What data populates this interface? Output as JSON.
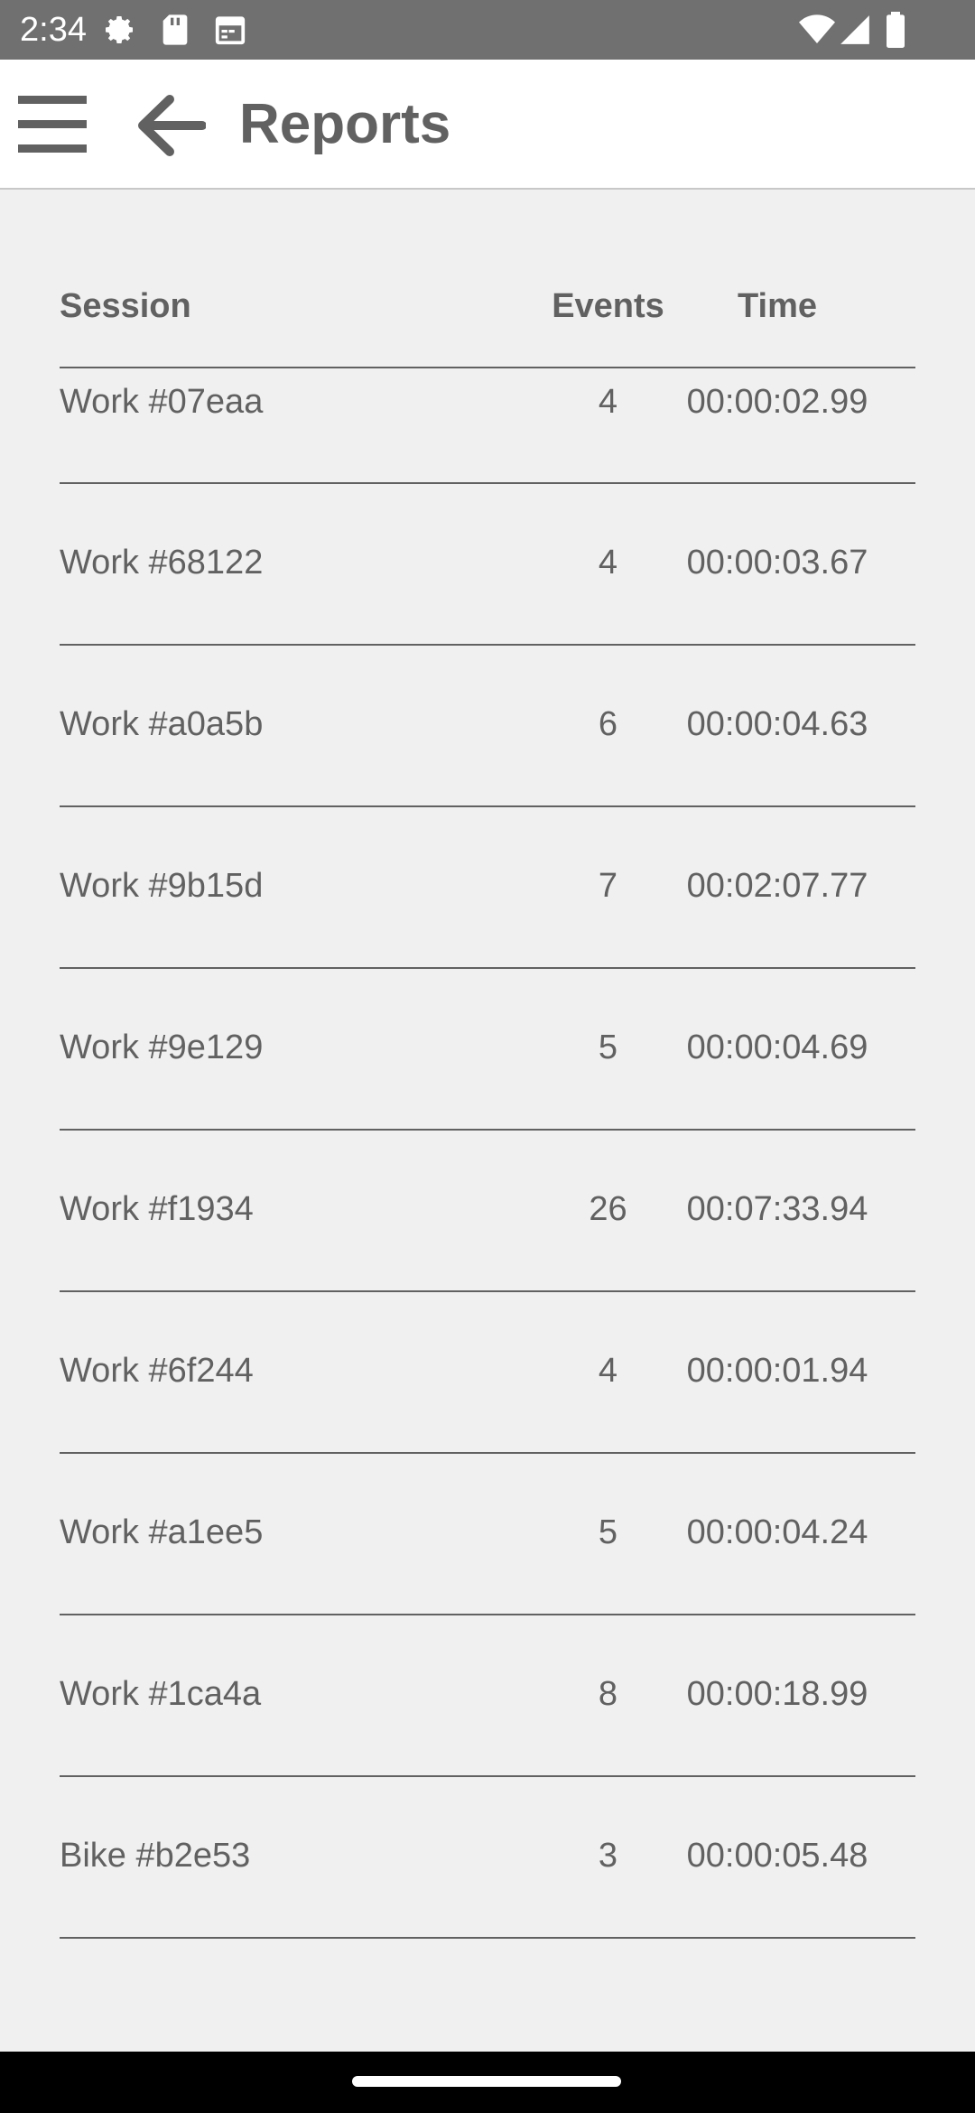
{
  "status_bar": {
    "time": "2:34",
    "icons": [
      "settings-icon",
      "sd-card-icon",
      "calendar-icon",
      "wifi-icon",
      "cell-signal-icon",
      "battery-icon"
    ]
  },
  "app_bar": {
    "title": "Reports",
    "menu_icon": "hamburger-menu-icon",
    "back_icon": "arrow-back-icon"
  },
  "table": {
    "headers": {
      "session": "Session",
      "events": "Events",
      "time": "Time"
    },
    "rows": [
      {
        "session": "Work #07eaa",
        "events": "4",
        "time": "00:00:02.99"
      },
      {
        "session": "Work #68122",
        "events": "4",
        "time": "00:00:03.67"
      },
      {
        "session": "Work #a0a5b",
        "events": "6",
        "time": "00:00:04.63"
      },
      {
        "session": "Work #9b15d",
        "events": "7",
        "time": "00:02:07.77"
      },
      {
        "session": "Work #9e129",
        "events": "5",
        "time": "00:00:04.69"
      },
      {
        "session": "Work #f1934",
        "events": "26",
        "time": "00:07:33.94"
      },
      {
        "session": "Work #6f244",
        "events": "4",
        "time": "00:00:01.94"
      },
      {
        "session": "Work #a1ee5",
        "events": "5",
        "time": "00:00:04.24"
      },
      {
        "session": "Work #1ca4a",
        "events": "8",
        "time": "00:00:18.99"
      },
      {
        "session": "Bike #b2e53",
        "events": "3",
        "time": "00:00:05.48"
      }
    ]
  },
  "colors": {
    "status_bar": "#707070",
    "app_bar": "#ffffff",
    "background": "#f0f0f0",
    "text": "#616161"
  }
}
